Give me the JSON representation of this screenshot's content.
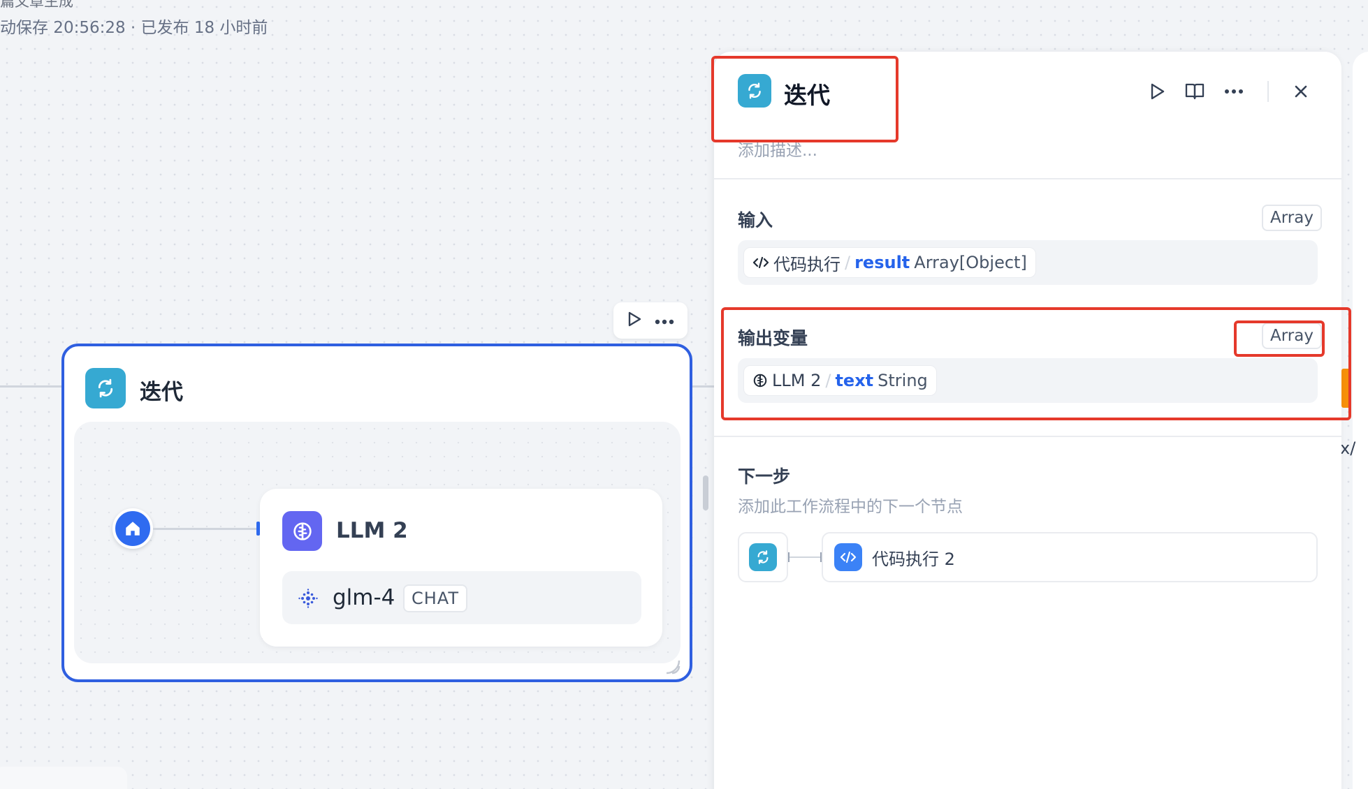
{
  "app": {
    "title": "篇文章生成",
    "status": "动保存 20:56:28 · 已发布 18 小时前"
  },
  "canvas": {
    "iteration_node": {
      "title": "迭代",
      "llm_node": {
        "title": "LLM 2",
        "model_name": "glm-4",
        "model_tag": "CHAT"
      }
    }
  },
  "panel": {
    "title": "迭代",
    "description_placeholder": "添加描述...",
    "input": {
      "label": "输入",
      "type": "Array",
      "node": "代码执行",
      "variable": "result",
      "var_type": "Array[Object]"
    },
    "output": {
      "label": "输出变量",
      "type": "Array",
      "node": "LLM 2",
      "variable": "text",
      "var_type": "String"
    },
    "next_step": {
      "label": "下一步",
      "description": "添加此工作流程中的下一个节点",
      "target": "代码执行 2"
    }
  },
  "right_edge_fragment": "x/",
  "colors": {
    "accent_blue": "#2f5fe0",
    "iteration_icon": "#36a9d2",
    "llm_icon": "#6366f1",
    "annotation_red": "#e5392b",
    "variable_blue": "#2563eb"
  },
  "icons": {
    "iteration": "loop-arrows-icon",
    "llm": "brain-icon",
    "start": "home-icon",
    "model": "zhipu-dots-icon",
    "code": "code-icon",
    "run": "play-icon",
    "docs": "book-icon",
    "more": "more-dots-icon",
    "close": "close-icon"
  }
}
